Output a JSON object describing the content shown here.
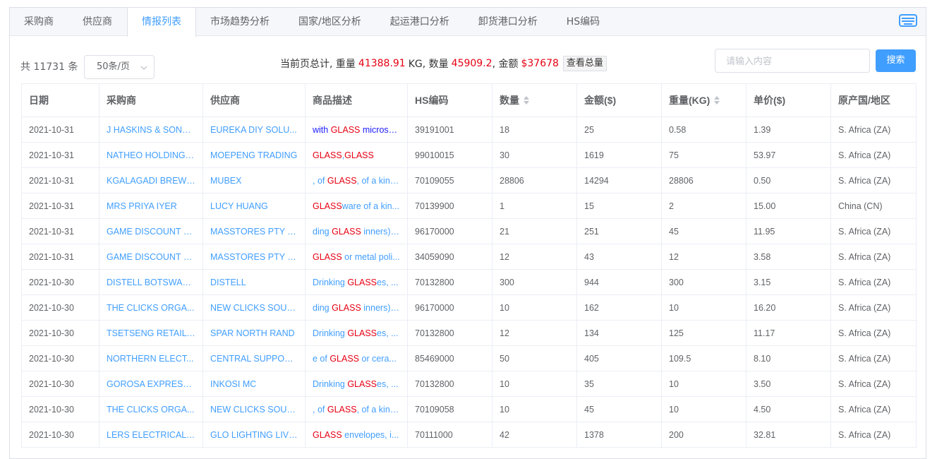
{
  "tabs": [
    "采购商",
    "供应商",
    "情报列表",
    "市场趋势分析",
    "国家/地区分析",
    "起运港口分析",
    "卸货港口分析",
    "HS编码"
  ],
  "active_tab": 2,
  "toolbar": {
    "total_prefix": "共",
    "total_count": "11731",
    "total_suffix": "条",
    "page_size": "50条/页",
    "summary_prefix": "当前页总计, 重量",
    "weight_value": "41388.91",
    "weight_unit": "KG, 数量",
    "qty_value": "45909.2",
    "amount_prefix": ", 金额",
    "amount_value": "$37678",
    "view_total_label": "查看总量",
    "search_placeholder": "请输入内容",
    "search_label": "搜索"
  },
  "table": {
    "headers": [
      "日期",
      "采购商",
      "供应商",
      "商品描述",
      "HS编码",
      "数量",
      "金额($)",
      "重量(KG)",
      "单价($)",
      "原产国/地区"
    ],
    "rows": [
      {
        "date": "2021-10-31",
        "buyer": "J HASKINS & SONS ...",
        "supplier": "EUREKA DIY SOLU...",
        "desc": [
          [
            "with ",
            0
          ],
          [
            "GLASS",
            1
          ],
          [
            " microsp...",
            0
          ]
        ],
        "desc_dark": true,
        "hs": "39191001",
        "qty": "18",
        "amount": "25",
        "weight": "0.58",
        "unit": "1.39",
        "origin": "S. Africa (ZA)"
      },
      {
        "date": "2021-10-31",
        "buyer": "NATHEO HOLDINGS...",
        "supplier": "MOEPENG TRADING",
        "desc": [
          [
            "GLASS",
            1
          ],
          [
            ",",
            0
          ],
          [
            "GLASS",
            1
          ]
        ],
        "hs": "99010015",
        "qty": "30",
        "amount": "1619",
        "weight": "75",
        "unit": "53.97",
        "origin": "S. Africa (ZA)"
      },
      {
        "date": "2021-10-31",
        "buyer": "KGALAGADI BREWE...",
        "supplier": "MUBEX",
        "desc": [
          [
            ", of ",
            0
          ],
          [
            "GLASS",
            1
          ],
          [
            ", of a kind...",
            0
          ]
        ],
        "hs": "70109055",
        "qty": "28806",
        "amount": "14294",
        "weight": "28806",
        "unit": "0.50",
        "origin": "S. Africa (ZA)"
      },
      {
        "date": "2021-10-31",
        "buyer": "MRS PRIYA IYER",
        "supplier": "LUCY HUANG",
        "desc": [
          [
            "GLASS",
            1
          ],
          [
            "ware of a kin...",
            0
          ]
        ],
        "hs": "70139900",
        "qty": "1",
        "amount": "15",
        "weight": "2",
        "unit": "15.00",
        "origin": "China (CN)"
      },
      {
        "date": "2021-10-31",
        "buyer": "GAME DISCOUNT W...",
        "supplier": "MASSTORES PTY LTD",
        "desc": [
          [
            "ding ",
            0
          ],
          [
            "GLASS",
            1
          ],
          [
            " inners),...",
            0
          ]
        ],
        "hs": "96170000",
        "qty": "21",
        "amount": "251",
        "weight": "45",
        "unit": "11.95",
        "origin": "S. Africa (ZA)"
      },
      {
        "date": "2021-10-31",
        "buyer": "GAME DISCOUNT W...",
        "supplier": "MASSTORES PTY LTD",
        "desc": [
          [
            "GLASS",
            1
          ],
          [
            " or metal poli...",
            0
          ]
        ],
        "hs": "34059090",
        "qty": "12",
        "amount": "43",
        "weight": "12",
        "unit": "3.58",
        "origin": "S. Africa (ZA)"
      },
      {
        "date": "2021-10-30",
        "buyer": "DISTELL BOTSWAN...",
        "supplier": "DISTELL",
        "desc": [
          [
            "Drinking ",
            0
          ],
          [
            "GLASS",
            1
          ],
          [
            "es, ...",
            0
          ]
        ],
        "hs": "70132800",
        "qty": "300",
        "amount": "944",
        "weight": "300",
        "unit": "3.15",
        "origin": "S. Africa (ZA)"
      },
      {
        "date": "2021-10-30",
        "buyer": "THE CLICKS ORGA...",
        "supplier": "NEW CLICKS SOUT...",
        "desc": [
          [
            "ding ",
            0
          ],
          [
            "GLASS",
            1
          ],
          [
            " inners),...",
            0
          ]
        ],
        "hs": "96170000",
        "qty": "10",
        "amount": "162",
        "weight": "10",
        "unit": "16.20",
        "origin": "S. Africa (ZA)"
      },
      {
        "date": "2021-10-30",
        "buyer": "TSETSENG RETAIL ...",
        "supplier": "SPAR NORTH RAND",
        "desc": [
          [
            "Drinking ",
            0
          ],
          [
            "GLASS",
            1
          ],
          [
            "es, ...",
            0
          ]
        ],
        "hs": "70132800",
        "qty": "12",
        "amount": "134",
        "weight": "125",
        "unit": "11.17",
        "origin": "S. Africa (ZA)"
      },
      {
        "date": "2021-10-30",
        "buyer": "NORTHERN ELECT...",
        "supplier": "CENTRAL SUPPOR...",
        "desc": [
          [
            "e of ",
            0
          ],
          [
            "GLASS",
            1
          ],
          [
            " or cera...",
            0
          ]
        ],
        "hs": "85469000",
        "qty": "50",
        "amount": "405",
        "weight": "109.5",
        "unit": "8.10",
        "origin": "S. Africa (ZA)"
      },
      {
        "date": "2021-10-30",
        "buyer": "GOROSA EXPRESS ...",
        "supplier": "INKOSI MC",
        "desc": [
          [
            "Drinking ",
            0
          ],
          [
            "GLASS",
            1
          ],
          [
            "es, ...",
            0
          ]
        ],
        "hs": "70132800",
        "qty": "10",
        "amount": "35",
        "weight": "10",
        "unit": "3.50",
        "origin": "S. Africa (ZA)"
      },
      {
        "date": "2021-10-30",
        "buyer": "THE CLICKS ORGA...",
        "supplier": "NEW CLICKS SOUT...",
        "desc": [
          [
            ", of ",
            0
          ],
          [
            "GLASS",
            1
          ],
          [
            ", of a kind...",
            0
          ]
        ],
        "hs": "70109058",
        "qty": "10",
        "amount": "45",
        "weight": "10",
        "unit": "4.50",
        "origin": "S. Africa (ZA)"
      },
      {
        "date": "2021-10-30",
        "buyer": "LERS ELECTRICAL ...",
        "supplier": "GLO LIGHTING LIVI...",
        "desc": [
          [
            "GLASS",
            1
          ],
          [
            " envelopes, i...",
            0
          ]
        ],
        "hs": "70111000",
        "qty": "42",
        "amount": "1378",
        "weight": "200",
        "unit": "32.81",
        "origin": "S. Africa (ZA)"
      }
    ]
  },
  "colors": {
    "accent": "#409eff",
    "highlight": "#e60012"
  },
  "icons": {
    "keyboard": "keyboard-icon",
    "chevron": "chevron-down-icon",
    "sort": "sort-caret-icon"
  }
}
